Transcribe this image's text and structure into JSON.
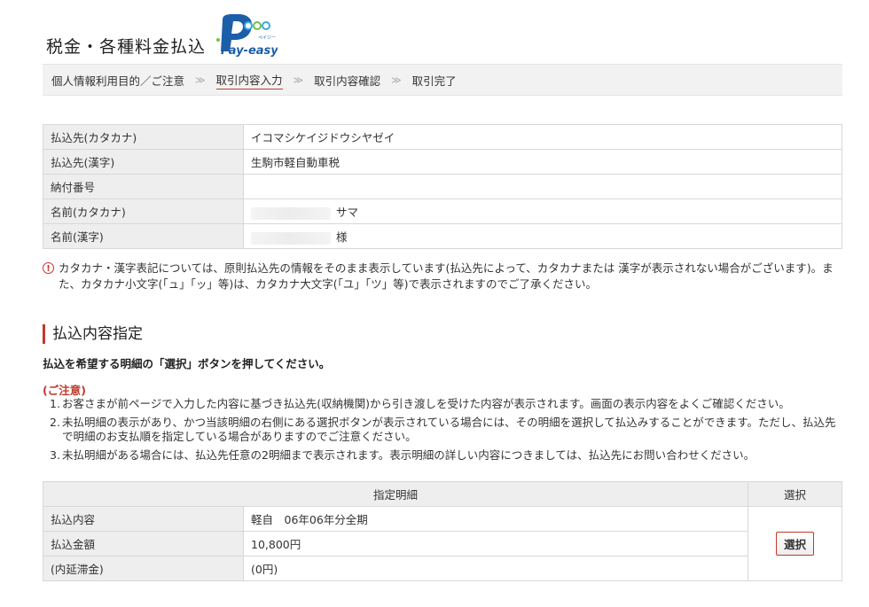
{
  "header": {
    "title": "税金・各種料金払込",
    "logo": {
      "main": "Pay-easy",
      "sub": "ペイジー"
    }
  },
  "steps": [
    {
      "label": "個人情報利用目的／ご注意",
      "current": false
    },
    {
      "label": "取引内容入力",
      "current": true
    },
    {
      "label": "取引内容確認",
      "current": false
    },
    {
      "label": "取引完了",
      "current": false
    }
  ],
  "step_separator": "≫",
  "payee_info": {
    "rows": [
      {
        "label": "払込先(カタカナ)",
        "value": "イコマシケイジドウシヤゼイ"
      },
      {
        "label": "払込先(漢字)",
        "value": "生駒市軽自動車税"
      },
      {
        "label": "納付番号",
        "value": ""
      },
      {
        "label": "名前(カタカナ)",
        "value": "サマ"
      },
      {
        "label": "名前(漢字)",
        "value": "様"
      }
    ]
  },
  "notice": "カタカナ・漢字表記については、原則払込先の情報をそのまま表示しています(払込先によって、カタカナまたは 漢字が表示されない場合がございます)。また、カタカナ小文字(「ュ」「ッ」等)は、カタカナ大文字(「ユ」「ツ」等)で表示されますのでご了承ください。",
  "section": {
    "title": "払込内容指定",
    "instruction": "払込を希望する明細の「選択」ボタンを押してください。",
    "caution_title": "(ご注意)",
    "cautions": [
      {
        "num": "1.",
        "text": "お客さまが前ページで入力した内容に基づき払込先(収納機関)から引き渡しを受けた内容が表示されます。画面の表示内容をよくご確認ください。"
      },
      {
        "num": "2.",
        "text": "未払明細の表示があり、かつ当該明細の右側にある選択ボタンが表示されている場合には、その明細を選択して払込みすることができます。ただし、払込先で明細のお支払順を指定している場合がありますのでご注意ください。"
      },
      {
        "num": "3.",
        "text": "未払明細がある場合には、払込先任意の2明細まで表示されます。表示明細の詳しい内容につきましては、払込先にお問い合わせください。"
      }
    ]
  },
  "detail_table": {
    "header_detail": "指定明細",
    "header_select": "選択",
    "rows": [
      {
        "label": "払込内容",
        "value": "軽自　06年06年分全期"
      },
      {
        "label": "払込金額",
        "value": "10,800円"
      },
      {
        "label": "(内延滞金)",
        "value": "(0円)"
      }
    ],
    "select_button": "選択"
  }
}
